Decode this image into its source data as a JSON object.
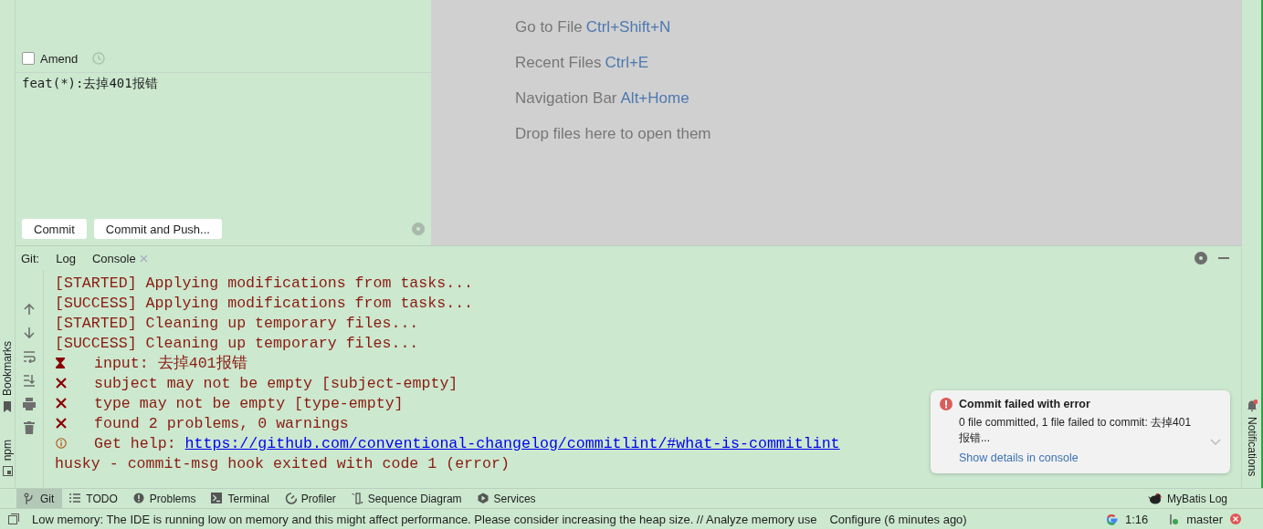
{
  "commit": {
    "amend": {
      "label": "Amend",
      "checked": false
    },
    "message": "feat(*):去掉401报错",
    "buttons": [
      "Commit",
      "Commit and Push..."
    ]
  },
  "editor_hints": [
    {
      "label": "Go to File",
      "shortcut": "Ctrl+Shift+N"
    },
    {
      "label": "Recent Files",
      "shortcut": "Ctrl+E"
    },
    {
      "label": "Navigation Bar",
      "shortcut": "Alt+Home"
    },
    {
      "label": "Drop files here to open them"
    }
  ],
  "tool_window": {
    "title": "Git:",
    "tabs": [
      {
        "label": "Log",
        "closable": false
      },
      {
        "label": "Console",
        "closable": true
      }
    ],
    "console_lines": [
      {
        "kind": "plain",
        "text": "[STARTED] Applying modifications from tasks..."
      },
      {
        "kind": "plain",
        "text": "[SUCCESS] Applying modifications from tasks..."
      },
      {
        "kind": "plain",
        "text": "[STARTED] Cleaning up temporary files..."
      },
      {
        "kind": "plain",
        "text": "[SUCCESS] Cleaning up temporary files..."
      },
      {
        "kind": "pending",
        "text": "input: 去掉401报错"
      },
      {
        "kind": "error",
        "text": "subject may not be empty [subject-empty]"
      },
      {
        "kind": "error",
        "text": "type may not be empty [type-empty]"
      },
      {
        "kind": "error",
        "text": "found 2 problems, 0 warnings"
      },
      {
        "kind": "info",
        "text": "Get help: ",
        "link": "https://github.com/conventional-changelog/commitlint/#what-is-commitlint"
      },
      {
        "kind": "plain",
        "text": "husky - commit-msg hook exited with code 1 (error)"
      }
    ]
  },
  "notification": {
    "title": "Commit failed with error",
    "body": "0 file committed, 1 file failed to commit: 去掉401报错...",
    "link": "Show details in console"
  },
  "side_tabs_left": [
    "Bookmarks",
    "npm"
  ],
  "side_tabs_right": [
    "Notifications"
  ],
  "tool_buttons": [
    {
      "label": "Git",
      "kind": "branch",
      "selected": true
    },
    {
      "label": "TODO",
      "kind": "list",
      "selected": false
    },
    {
      "label": "Problems",
      "kind": "alert",
      "selected": false
    },
    {
      "label": "Terminal",
      "kind": "terminal",
      "selected": false
    },
    {
      "label": "Profiler",
      "kind": "profiler",
      "selected": false
    },
    {
      "label": "Sequence Diagram",
      "kind": "sequence",
      "selected": false
    },
    {
      "label": "Services",
      "kind": "services",
      "selected": false
    }
  ],
  "tool_buttons_right": [
    {
      "label": "MyBatis Log",
      "kind": "bird",
      "selected": false
    }
  ],
  "status_bar": {
    "message": "Low memory: The IDE is running low on memory and this might affect performance. Please consider increasing the heap size. // Analyze memory use",
    "action": "Configure (6 minutes ago)",
    "position": "1:16",
    "branch": "master"
  }
}
